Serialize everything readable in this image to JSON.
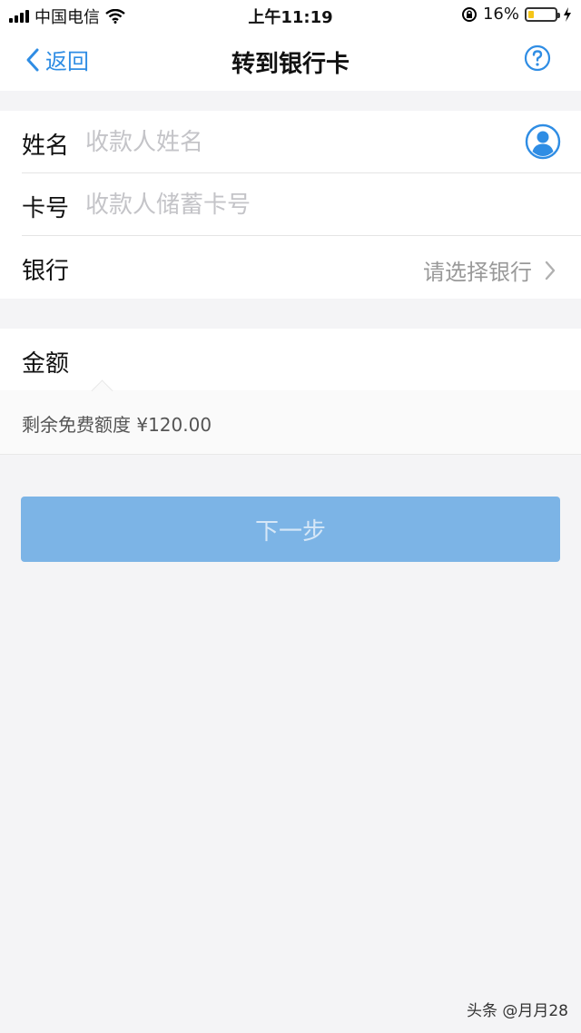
{
  "status_bar": {
    "carrier": "中国电信",
    "time": "上午11:19",
    "battery_percent": "16%",
    "battery_level": 0.16,
    "icons": [
      "signal-icon",
      "wifi-icon",
      "rotation-lock-icon",
      "battery-icon",
      "charging-icon"
    ]
  },
  "nav": {
    "back_label": "返回",
    "title": "转到银行卡",
    "help_icon": "question-circle-icon"
  },
  "form": {
    "name": {
      "label": "姓名",
      "placeholder": "收款人姓名",
      "value": ""
    },
    "card": {
      "label": "卡号",
      "placeholder": "收款人储蓄卡号",
      "value": ""
    },
    "bank": {
      "label": "银行",
      "placeholder": "请选择银行"
    },
    "amount": {
      "label": "金额"
    },
    "free_quota": "剩余免费额度 ¥120.00"
  },
  "actions": {
    "next_label": "下一步"
  },
  "watermark": "头条 @月月28",
  "colors": {
    "accent": "#2f8de4",
    "button_bg": "#7cb4e6",
    "button_text": "#d6e7f7",
    "page_bg": "#f4f4f6"
  }
}
